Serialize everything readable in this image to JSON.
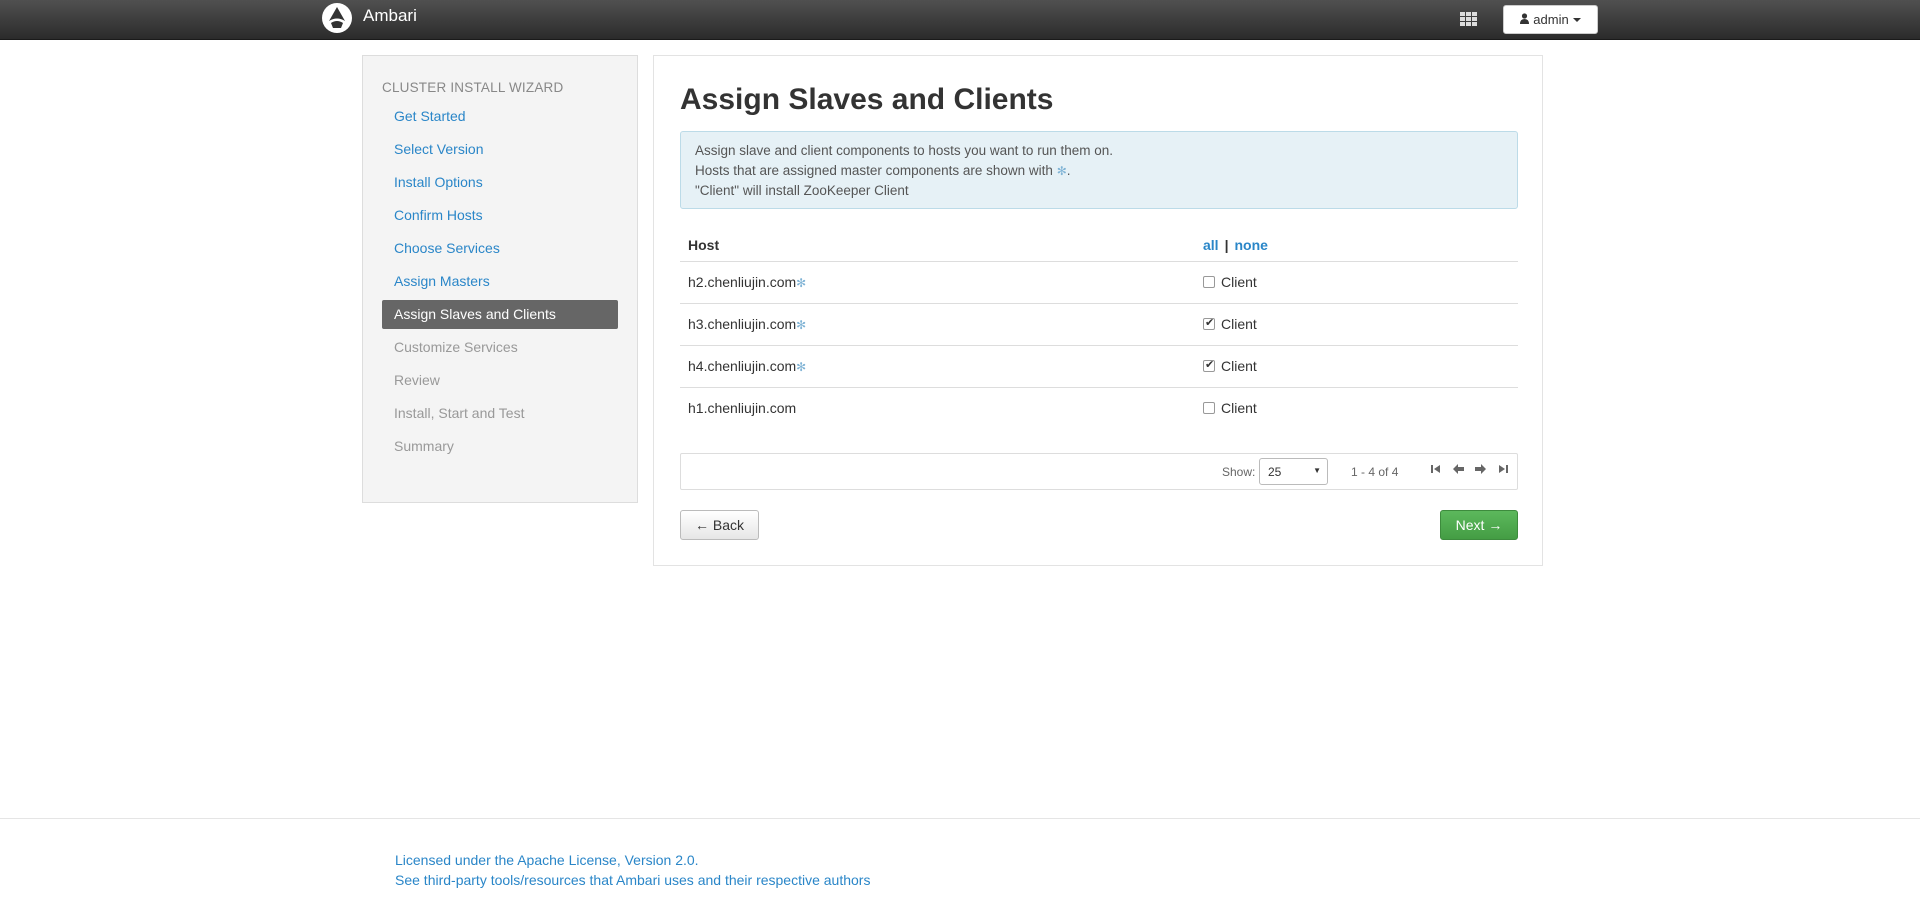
{
  "app": {
    "name": "Ambari",
    "logo_icon": "ambari-logo-icon"
  },
  "header": {
    "apps_icon": "grid-icon",
    "user_label": "admin",
    "user_icon": "user-icon"
  },
  "sidebar": {
    "title": "CLUSTER INSTALL WIZARD",
    "items": [
      {
        "label": "Get Started",
        "state": "link"
      },
      {
        "label": "Select Version",
        "state": "link"
      },
      {
        "label": "Install Options",
        "state": "link"
      },
      {
        "label": "Confirm Hosts",
        "state": "link"
      },
      {
        "label": "Choose Services",
        "state": "link"
      },
      {
        "label": "Assign Masters",
        "state": "link"
      },
      {
        "label": "Assign Slaves and Clients",
        "state": "active"
      },
      {
        "label": "Customize Services",
        "state": "disabled"
      },
      {
        "label": "Review",
        "state": "disabled"
      },
      {
        "label": "Install, Start and Test",
        "state": "disabled"
      },
      {
        "label": "Summary",
        "state": "disabled"
      }
    ]
  },
  "main": {
    "title": "Assign Slaves and Clients",
    "info": {
      "line1": "Assign slave and client components to hosts you want to run them on.",
      "line2_prefix": "Hosts that are assigned master components are shown with",
      "line2_suffix": ".",
      "line3": "\"Client\" will install ZooKeeper Client",
      "master_marker": "✻"
    },
    "table": {
      "host_header": "Host",
      "all_link": "all",
      "separator": "|",
      "none_link": "none",
      "rows": [
        {
          "host": "h2.chenliujin.com",
          "master": "✻",
          "client_label": "Client",
          "checked": false
        },
        {
          "host": "h3.chenliujin.com",
          "master": "✻",
          "client_label": "Client",
          "checked": true
        },
        {
          "host": "h4.chenliujin.com",
          "master": "✻",
          "client_label": "Client",
          "checked": true
        },
        {
          "host": "h1.chenliujin.com",
          "master": "",
          "client_label": "Client",
          "checked": false
        }
      ]
    },
    "pager": {
      "show_label": "Show:",
      "page_size": "25",
      "range": "1 - 4 of 4",
      "first": "⏮",
      "prev": "🡐",
      "next": "🡒",
      "last": "⏭"
    },
    "back_button": "← Back",
    "next_button": "Next →"
  },
  "footer": {
    "license_link": "Licensed under the Apache License, Version 2.0.",
    "thirdparty_link": "See third-party tools/resources that Ambari uses and their respective authors"
  },
  "colors": {
    "link": "#2a86c8",
    "active_nav": "#666666",
    "next_button": "#5cb85c",
    "navbar": "#333333"
  }
}
